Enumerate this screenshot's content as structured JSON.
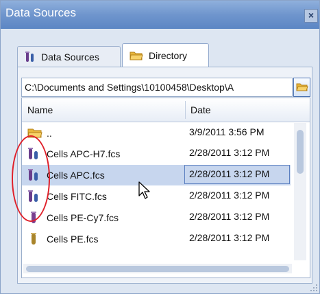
{
  "window": {
    "title": "Data Sources",
    "close_glyph": "×"
  },
  "tabs": [
    {
      "label": "Data Sources",
      "icon": "test-tube-icon",
      "active": false
    },
    {
      "label": "Directory",
      "icon": "folder-icon",
      "active": true
    }
  ],
  "path": {
    "value": "C:\\Documents and Settings\\10100458\\Desktop\\A"
  },
  "list": {
    "columns": {
      "name": "Name",
      "date": "Date"
    },
    "rows": [
      {
        "name": "..",
        "date": "3/9/2011 3:56 PM",
        "icon": "folder-icon"
      },
      {
        "name": "Cells APC-H7.fcs",
        "date": "2/28/2011 3:12 PM",
        "icon": "fcs-tube-icon"
      },
      {
        "name": "Cells APC.fcs",
        "date": "2/28/2011 3:12 PM",
        "icon": "fcs-tube-icon",
        "selected": true
      },
      {
        "name": "Cells FITC.fcs",
        "date": "2/28/2011 3:12 PM",
        "icon": "fcs-tube-icon"
      },
      {
        "name": "Cells PE-Cy7.fcs",
        "date": "2/28/2011 3:12 PM",
        "icon": "single-tube-icon"
      },
      {
        "name": "Cells PE.fcs",
        "date": "2/28/2011 3:12 PM",
        "icon": "single-tube-icon"
      }
    ]
  },
  "colors": {
    "title_bar": "#6f95cd",
    "selection": "#c7d6ee",
    "annotation": "#e0202a"
  }
}
